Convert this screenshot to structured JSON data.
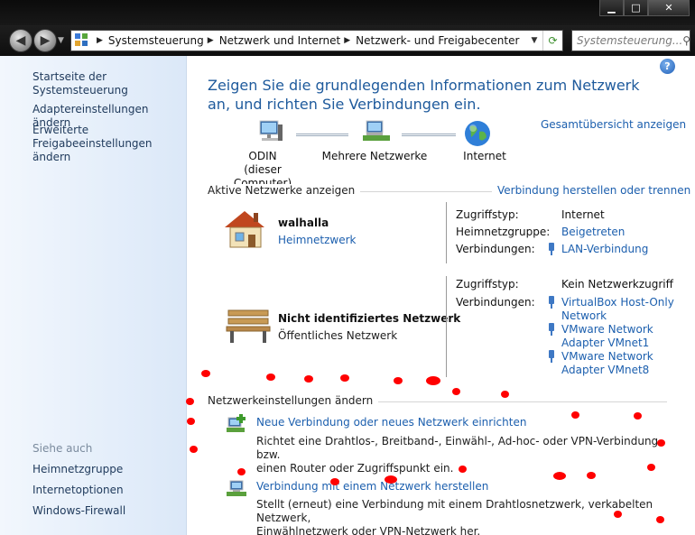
{
  "window": {
    "caption": {
      "minimize": "▁",
      "maximize": "□",
      "close": "✕"
    }
  },
  "address_bar": {
    "breadcrumbs": [
      "Systemsteuerung",
      "Netzwerk und Internet",
      "Netzwerk- und Freigabecenter"
    ],
    "search_placeholder": "Systemsteuerung..."
  },
  "sidebar": {
    "links": [
      "Startseite der Systemsteuerung",
      "Adaptereinstellungen ändern",
      "Erweiterte Freigabeeinstellungen ändern"
    ],
    "see_also_heading": "Siehe auch",
    "see_also": [
      "Heimnetzgruppe",
      "Internetoptionen",
      "Windows-Firewall"
    ]
  },
  "main": {
    "heading": "Zeigen Sie die grundlegenden Informationen zum Netzwerk an, und richten Sie Verbindungen ein.",
    "full_map_link": "Gesamtübersicht anzeigen",
    "map_nodes": [
      {
        "label": "ODIN",
        "sublabel": "(dieser Computer)"
      },
      {
        "label": "Mehrere Netzwerke"
      },
      {
        "label": "Internet"
      }
    ],
    "active_networks": {
      "title": "Aktive Netzwerke anzeigen",
      "action_link": "Verbindung herstellen oder trennen",
      "networks": [
        {
          "name": "walhalla",
          "type": "Heimnetzwerk",
          "access_label": "Zugriffstyp:",
          "access_value": "Internet",
          "homegroup_label": "Heimnetzgruppe:",
          "homegroup_value": "Beigetreten",
          "connections_label": "Verbindungen:",
          "connections": [
            "LAN-Verbindung"
          ]
        },
        {
          "name": "Nicht identifiziertes Netzwerk",
          "type": "Öffentliches Netzwerk",
          "access_label": "Zugriffstyp:",
          "access_value": "Kein Netzwerkzugriff",
          "connections_label": "Verbindungen:",
          "connections": [
            [
              "VirtualBox Host-Only",
              "Network"
            ],
            [
              "VMware Network",
              "Adapter VMnet1"
            ],
            [
              "VMware Network",
              "Adapter VMnet8"
            ]
          ]
        }
      ]
    },
    "change_settings": {
      "title": "Netzwerkeinstellungen ändern",
      "tasks": [
        {
          "link": "Neue Verbindung oder neues Netzwerk einrichten",
          "description_lines": [
            "Richtet eine Drahtlos-, Breitband-, Einwähl-, Ad-hoc- oder VPN-Verbindung bzw.",
            "einen Router oder Zugriffspunkt ein."
          ]
        },
        {
          "link": "Verbindung mit einem Netzwerk herstellen",
          "description_lines": [
            "Stellt (erneut) eine Verbindung mit einem Drahtlosnetzwerk, verkabelten Netzwerk,",
            "Einwählnetzwerk oder VPN-Netzwerk her."
          ]
        }
      ]
    }
  },
  "colors": {
    "link": "#1c5fae",
    "heading": "#1e5a9c",
    "annotation_dot": "#ff0000"
  }
}
